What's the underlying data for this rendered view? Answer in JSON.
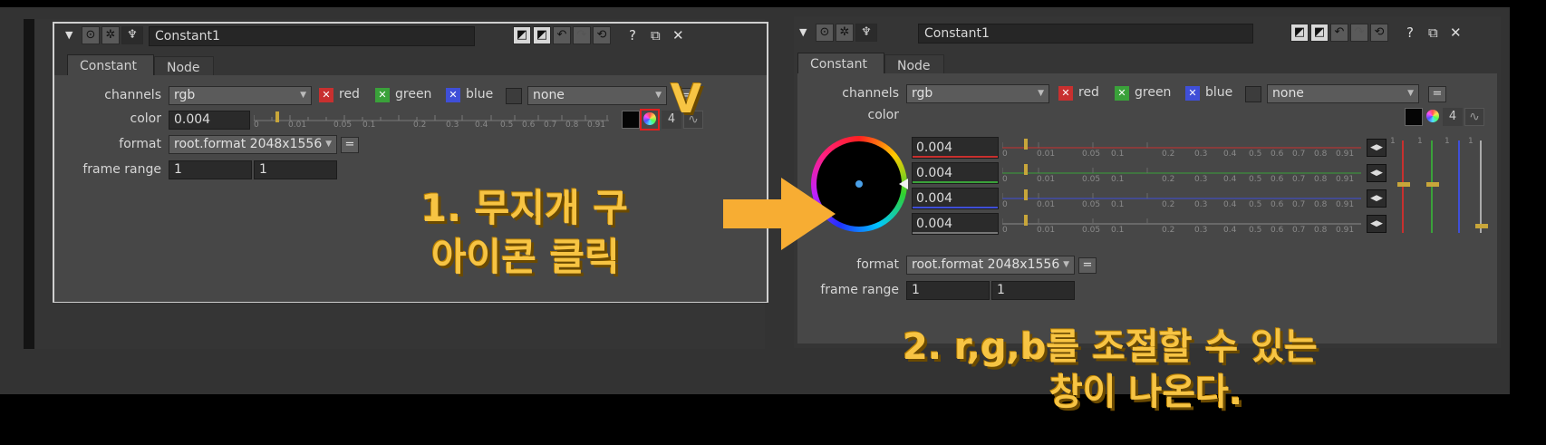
{
  "left_panel": {
    "node_name": "Constant1",
    "title_symbols": [
      "?",
      "⧉",
      "✕"
    ],
    "tabs": [
      {
        "label": "Constant"
      },
      {
        "label": "Node"
      }
    ],
    "channels": {
      "label": "channels",
      "value": "rgb",
      "checks": [
        "red",
        "green",
        "blue"
      ],
      "extra": "none"
    },
    "color": {
      "label": "color",
      "value": "0.004",
      "num_button": "4"
    },
    "format": {
      "label": "format",
      "value": "root.format 2048x1556"
    },
    "frame_range": {
      "label": "frame range",
      "start": "1",
      "end": "1"
    },
    "equals": "=",
    "ticks": [
      "0",
      "0.01",
      "0.05",
      "0.1",
      "0.2",
      "0.3",
      "0.4",
      "0.5",
      "0.6",
      "0.7",
      "0.8",
      "0.91"
    ]
  },
  "right_panel": {
    "node_name": "Constant1",
    "title_symbols": [
      "?",
      "⧉",
      "✕"
    ],
    "tabs": [
      {
        "label": "Constant"
      },
      {
        "label": "Node"
      }
    ],
    "channels": {
      "label": "channels",
      "value": "rgb",
      "checks": [
        "red",
        "green",
        "blue"
      ],
      "extra": "none"
    },
    "color": {
      "label": "color",
      "num_button": "4",
      "r": "0.004",
      "g": "0.004",
      "b": "0.004",
      "a": "0.004"
    },
    "format": {
      "label": "format",
      "value": "root.format 2048x1556"
    },
    "frame_range": {
      "label": "frame range",
      "start": "1",
      "end": "1"
    },
    "equals": "=",
    "ticks": [
      "0",
      "0.01",
      "0.05",
      "0.1",
      "0.2",
      "0.3",
      "0.4",
      "0.5",
      "0.6",
      "0.7",
      "0.8",
      "0.91"
    ],
    "side_ticks": "1"
  },
  "annotations": {
    "check_mark": "V",
    "step1_line1": "1. 무지개 구",
    "step1_line2": "아이콘 클릭",
    "step2_line1": "2. r,g,b를 조절할 수 있는",
    "step2_line2": "창이 나온다."
  },
  "colors": {
    "accent": "#f7ad33",
    "red": "#c8302f",
    "green": "#3aa13a",
    "blue": "#3f4fd8",
    "highlight_box": "#e02020"
  }
}
